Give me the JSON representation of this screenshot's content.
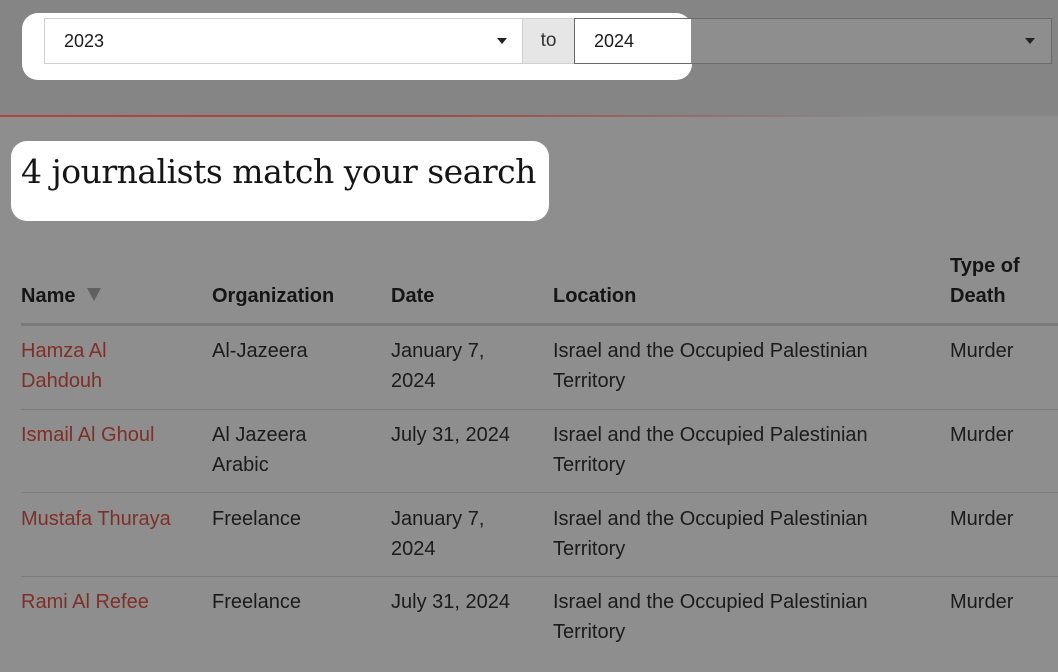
{
  "filter": {
    "year_from": "2023",
    "separator": "to",
    "year_to": "2024"
  },
  "results": {
    "heading": "4 journalists match your search"
  },
  "table": {
    "columns": [
      "Name",
      "Organization",
      "Date",
      "Location",
      "Type of Death"
    ],
    "rows": [
      {
        "name": "Hamza Al Dahdouh",
        "organization": "Al-Jazeera",
        "date": "January 7, 2024",
        "location": "Israel and the Occupied Palestinian Territory",
        "type": "Murder"
      },
      {
        "name": "Ismail Al Ghoul",
        "organization": "Al Jazeera Arabic",
        "date": "July 31, 2024",
        "location": "Israel and the Occupied Palestinian Territory",
        "type": "Murder"
      },
      {
        "name": "Mustafa Thuraya",
        "organization": "Freelance",
        "date": "January 7, 2024",
        "location": "Israel and the Occupied Palestinian Territory",
        "type": "Murder"
      },
      {
        "name": "Rami Al Refee",
        "organization": "Freelance",
        "date": "July 31, 2024",
        "location": "Israel and the Occupied Palestinian Territory",
        "type": "Murder"
      }
    ]
  },
  "colors": {
    "link": "#7e2f27",
    "accent_rule": "#b2463c",
    "overlay": "#8e8e8e"
  },
  "icons": {
    "sort": "sort-down-triangle-icon",
    "dropdown": "caret-down-icon"
  }
}
